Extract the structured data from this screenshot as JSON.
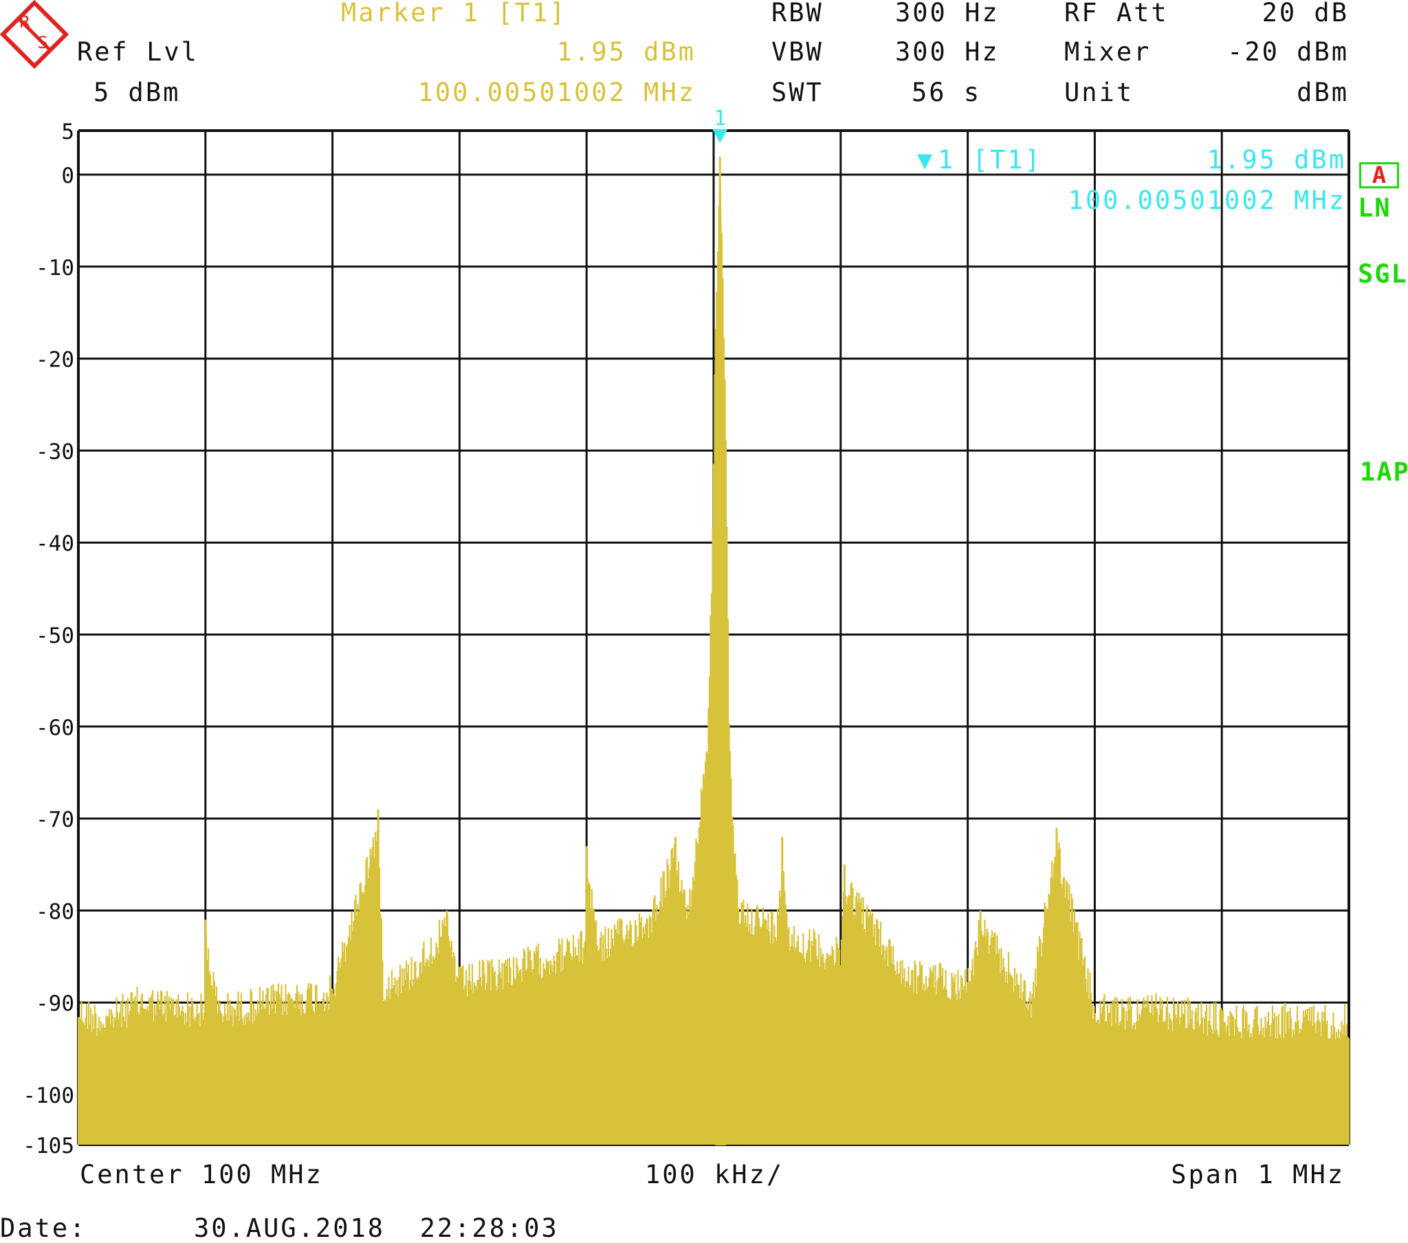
{
  "header": {
    "marker_title": "Marker 1 [T1]",
    "ref_lvl_label": "Ref Lvl",
    "ref_lvl_value": "5 dBm",
    "marker_level": "1.95 dBm",
    "marker_freq": "100.00501002 MHz",
    "rbw_label": "RBW",
    "rbw_value": "300 Hz",
    "vbw_label": "VBW",
    "vbw_value": "300 Hz",
    "swt_label": "SWT",
    "swt_value": "56 s",
    "rfatt_label": "RF Att",
    "rfatt_value": "20 dB",
    "mixer_label": "Mixer",
    "mixer_value": "-20 dBm",
    "unit_label": "Unit",
    "unit_value": "dBm"
  },
  "marker_readout": {
    "marker_number": "1",
    "label": "1 [T1]",
    "level": "1.95 dBm",
    "freq": "100.00501002 MHz"
  },
  "side_labels": {
    "trace_box": "A",
    "ln": "LN",
    "sgl": "SGL",
    "ap": "1AP"
  },
  "footer": {
    "center": "Center 100 MHz",
    "per_div": "100 kHz/",
    "span": "Span 1 MHz",
    "date_label": "Date:",
    "date_value": "30.AUG.2018  22:28:03"
  },
  "colors": {
    "trace": "#d8c23a",
    "marker": "#39e7ee",
    "grid": "#111111",
    "status": "#1ed80a",
    "logo": "#e0231d"
  },
  "chart_data": {
    "type": "line",
    "title": "",
    "xlabel": "",
    "ylabel": "",
    "x_unit": "MHz",
    "xlim": [
      99.5,
      100.5
    ],
    "ylim": [
      -105,
      5
    ],
    "grid": true,
    "yticks": [
      "5",
      "0",
      "-10",
      "-20",
      "-30",
      "-40",
      "-50",
      "-60",
      "-70",
      "-80",
      "-90",
      "-100",
      "-105"
    ],
    "noise_floor_dBm": -91,
    "series": [
      {
        "values": [
          [
            99.5,
            -89
          ],
          [
            99.52,
            -90
          ],
          [
            99.55,
            -88
          ],
          [
            99.6,
            -89
          ],
          [
            99.6,
            -81
          ],
          [
            99.61,
            -89
          ],
          [
            99.65,
            -88
          ],
          [
            99.7,
            -87
          ],
          [
            99.736,
            -69
          ],
          [
            99.74,
            -86
          ],
          [
            99.76,
            -85
          ],
          [
            99.79,
            -80
          ],
          [
            99.8,
            -86
          ],
          [
            99.85,
            -84
          ],
          [
            99.9,
            -82
          ],
          [
            99.9,
            -73
          ],
          [
            99.91,
            -82
          ],
          [
            99.95,
            -79
          ],
          [
            99.97,
            -72
          ],
          [
            99.98,
            -79
          ],
          [
            99.995,
            -60
          ],
          [
            99.998,
            -45
          ],
          [
            100.001,
            -20
          ],
          [
            100.005,
            1.95
          ],
          [
            100.009,
            -20
          ],
          [
            100.012,
            -55
          ],
          [
            100.015,
            -70
          ],
          [
            100.02,
            -78
          ],
          [
            100.05,
            -80
          ],
          [
            100.054,
            -72
          ],
          [
            100.06,
            -81
          ],
          [
            100.1,
            -83
          ],
          [
            100.103,
            -75
          ],
          [
            100.15,
            -85
          ],
          [
            100.2,
            -86
          ],
          [
            100.21,
            -80
          ],
          [
            100.25,
            -88
          ],
          [
            100.27,
            -71
          ],
          [
            100.3,
            -89
          ],
          [
            100.35,
            -89
          ],
          [
            100.4,
            -90
          ],
          [
            100.45,
            -90
          ],
          [
            100.5,
            -90
          ]
        ]
      }
    ]
  }
}
